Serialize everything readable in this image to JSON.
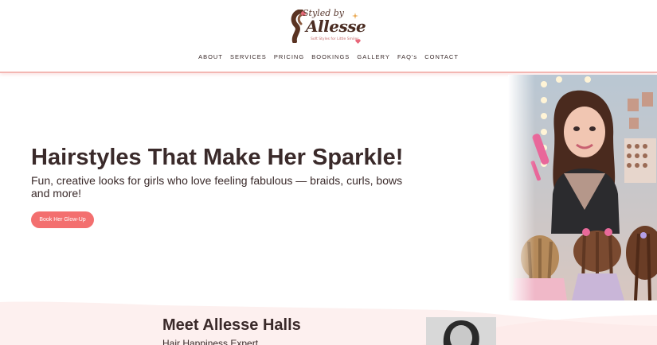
{
  "logo": {
    "script": "Styled by",
    "name": "Allesse",
    "tagline": "Soft Styles for Little Smiles"
  },
  "nav": {
    "items": [
      {
        "label": "ABOUT"
      },
      {
        "label": "SERVICES"
      },
      {
        "label": "PRICING"
      },
      {
        "label": "BOOKINGS"
      },
      {
        "label": "GALLERY"
      },
      {
        "label": "FAQ's"
      },
      {
        "label": "CONTACT"
      }
    ]
  },
  "hero": {
    "title": "Hairstyles That Make Her Sparkle!",
    "subtitle": "Fun, creative looks for girls who love feeling fabulous — braids, curls, bows and more!",
    "button": "Book Her Glow-Up"
  },
  "meet": {
    "title": "Meet Allesse Halls",
    "subtitle": "Hair Happiness Expert"
  },
  "colors": {
    "accent": "#f36f6f",
    "header_border": "#f3b7b3",
    "band": "#fdf1f0",
    "text": "#3a2a2a"
  }
}
